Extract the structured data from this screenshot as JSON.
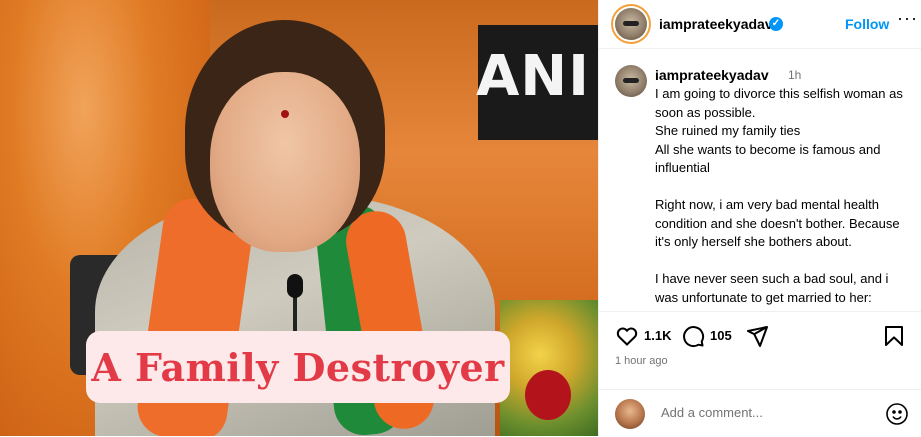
{
  "media": {
    "banner_text": "ANI",
    "overlay_caption": "A Family Destroyer"
  },
  "header": {
    "username": "iamprateekyadav",
    "verified_glyph": "✓",
    "follow_label": "Follow",
    "more_glyph": "···"
  },
  "caption": {
    "username": "iamprateekyadav",
    "time": "1h",
    "text": "I am going to divorce this selfish woman as soon as possible.\nShe ruined my family ties\nAll she wants to become is famous and influential\n\nRight now, i am very bad mental health condition and she doesn't bother. Because it's only herself she bothers about.\n\nI have never seen such a bad soul, and i was unfortunate to get married to her:"
  },
  "actions": {
    "likes": "1.1K",
    "comments": "105",
    "posted": "1 hour ago"
  },
  "comment_box": {
    "placeholder": "Add a comment..."
  },
  "colors": {
    "accent": "#0095f6",
    "caption_text": "#e23b47",
    "caption_bg": "#fde9ea"
  }
}
